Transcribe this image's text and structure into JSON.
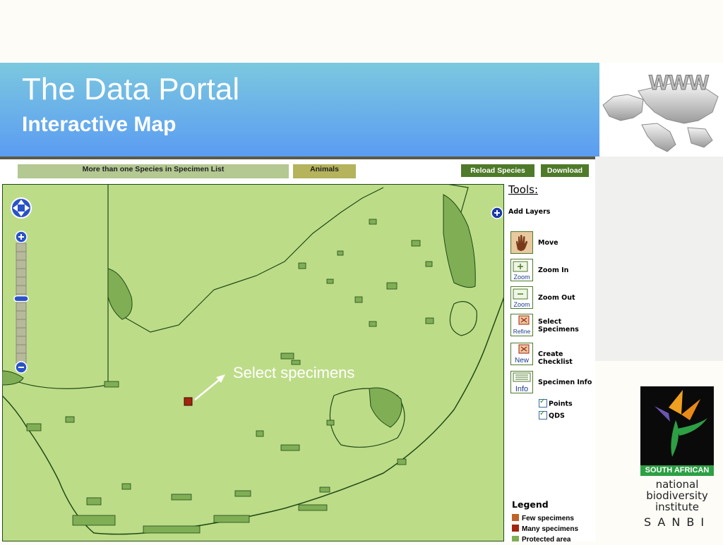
{
  "banner": {
    "title": "The Data Portal",
    "subtitle": "Interactive Map"
  },
  "globe": {
    "text": "WWW"
  },
  "toolbar": {
    "species_label": "More than one Species in Specimen List",
    "animals_label": "Animals",
    "reload_label": "Reload Species",
    "download_label": "Download"
  },
  "tools": {
    "title": "Tools:",
    "add_layers": "Add Layers",
    "items": [
      {
        "label": "Move",
        "icon_text": "",
        "icon": "hand-icon"
      },
      {
        "label": "Zoom In",
        "icon_text": "Zoom",
        "icon": "zoom-in-icon"
      },
      {
        "label": "Zoom Out",
        "icon_text": "Zoom",
        "icon": "zoom-out-icon"
      },
      {
        "label": "Select Specimens",
        "icon_text": "Refine",
        "icon": "refine-icon"
      },
      {
        "label": "Create Checklist",
        "icon_text": "New",
        "icon": "new-checklist-icon"
      },
      {
        "label": "Specimen Info",
        "icon_text": "Info",
        "icon": "info-icon"
      }
    ],
    "checks": [
      {
        "label": "Points",
        "checked": true
      },
      {
        "label": "QDS",
        "checked": true
      }
    ]
  },
  "legend": {
    "title": "Legend",
    "items": [
      {
        "label": "Few specimens",
        "color": "#c0622a"
      },
      {
        "label": "Many specimens",
        "color": "#a3250d"
      },
      {
        "label": "Protected area",
        "color": "#7fae55"
      }
    ]
  },
  "map": {
    "annotation": "Select specimens",
    "zoom_level": 0.38
  },
  "sanbi": {
    "band": "SOUTH AFRICAN",
    "line1": "national",
    "line2": "biodiversity",
    "line3": "institute",
    "acronym": "SANBI"
  },
  "colors": {
    "land": "#bddc88",
    "protected": "#7fae55",
    "border": "#1f4a14",
    "button": "#4e7a29"
  }
}
